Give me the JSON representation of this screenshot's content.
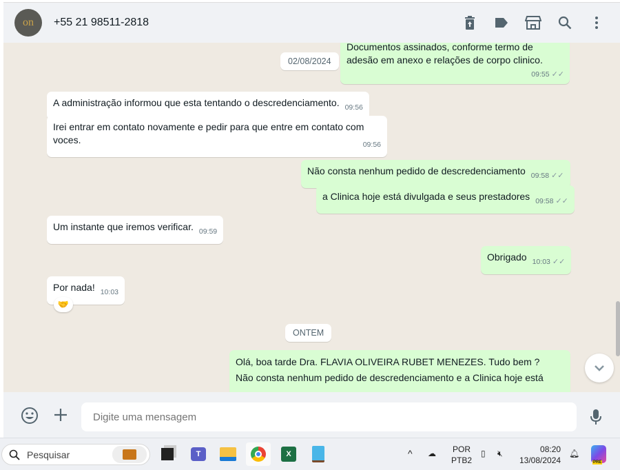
{
  "header": {
    "contact": "+55 21 98511-2818",
    "avatar_initials": "on"
  },
  "messages": [
    {
      "dir": "out",
      "text": "Documentos assinados,  conforme termo de",
      "text2": "adesão em anexo e relações de corpo clinico.",
      "time": "09:55"
    },
    {
      "dir": "in",
      "text": "A administração informou que esta tentando o descredenciamento.",
      "time": "09:56"
    },
    {
      "dir": "in",
      "text": "Irei entrar em contato novamente e pedir para que entre em contato com voces.",
      "time": "09:56"
    },
    {
      "dir": "out",
      "text": "Não consta nenhum pedido de descredenciamento",
      "time": "09:58"
    },
    {
      "dir": "out",
      "text": "a Clinica hoje está divulgada e seus prestadores",
      "time": "09:58"
    },
    {
      "dir": "in",
      "text": "Um instante que iremos verificar.",
      "time": "09:59"
    },
    {
      "dir": "out",
      "text": "Obrigado",
      "time": "10:03"
    },
    {
      "dir": "in",
      "text": "Por nada!",
      "time": "10:03",
      "reaction": "🤝"
    },
    {
      "dir": "out",
      "text": "Olá, boa tarde Dra. FLAVIA OLIVEIRA RUBET MENEZES. Tudo bem ?",
      "text2": "Não consta nenhum pedido de descredenciamento e a Clinica hoje está"
    }
  ],
  "dates": {
    "first": "02/08/2024",
    "second": "ONTEM"
  },
  "footer": {
    "placeholder": "Digite uma mensagem"
  },
  "taskbar": {
    "search": "Pesquisar",
    "lang1": "POR",
    "lang2": "PTB2",
    "time": "08:20",
    "date": "13/08/2024",
    "copilot_badge": "PRE"
  }
}
